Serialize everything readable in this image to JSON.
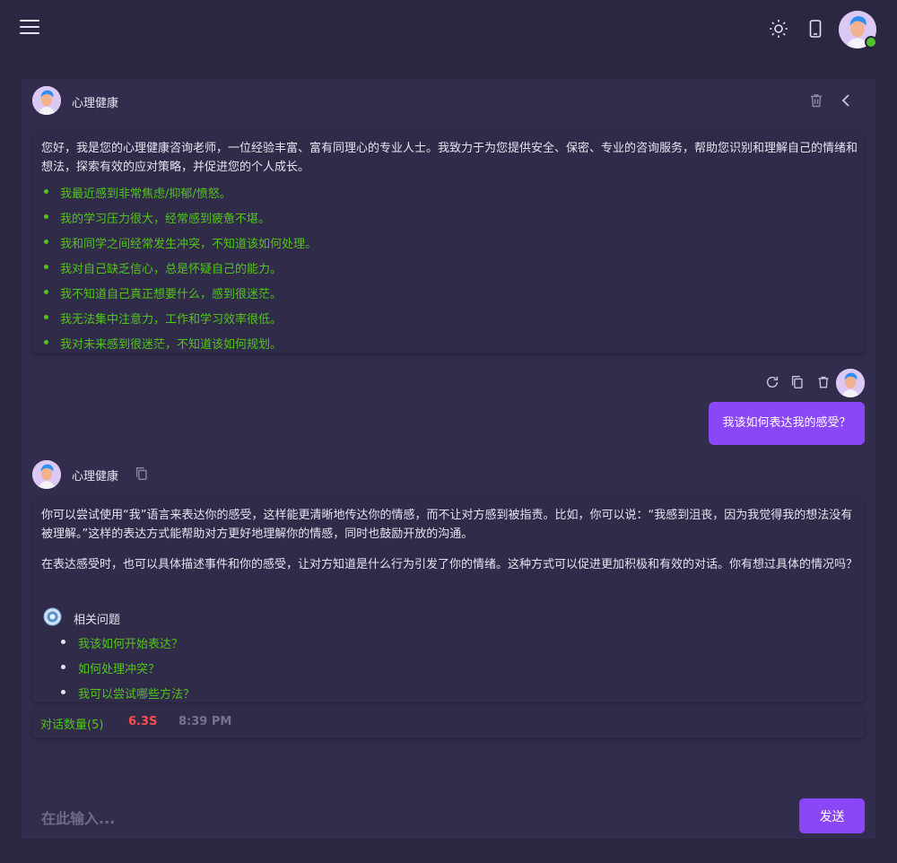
{
  "topbar": {
    "icons": {
      "menu": "menu-icon",
      "theme": "sun-icon",
      "device": "mobile-icon",
      "avatar": "user-avatar"
    },
    "online_color": "#4fc32a"
  },
  "chat": {
    "bot_name": "心理健康",
    "intro": {
      "text": "您好，我是您的心理健康咨询老师，一位经验丰富、富有同理心的专业人士。我致力于为您提供安全、保密、专业的咨询服务，帮助您识别和理解自己的情绪和想法，探索有效的应对策略，并促进您的个人成长。",
      "suggestions": [
        "我最近感到非常焦虑/抑郁/愤怒。",
        "我的学习压力很大，经常感到疲惫不堪。",
        "我和同学之间经常发生冲突，不知道该如何处理。",
        "我对自己缺乏信心，总是怀疑自己的能力。",
        "我不知道自己真正想要什么，感到很迷茫。",
        "我无法集中注意力，工作和学习效率很低。",
        "我对未来感到很迷茫，不知道该如何规划。"
      ]
    },
    "user_message": "我该如何表达我的感受？",
    "answer": {
      "paragraphs": [
        "你可以尝试使用“我”语言来表达你的感受，这样能更清晰地传达你的情感，而不让对方感到被指责。比如，你可以说：“我感到沮丧，因为我觉得我的想法没有被理解。”这样的表达方式能帮助对方更好地理解你的情感，同时也鼓励开放的沟通。",
        "在表达感受时，也可以具体描述事件和你的感受，让对方知道是什么行为引发了你的情绪。这种方式可以促进更加积极和有效的对话。你有想过具体的情况吗？"
      ],
      "related_title": "相关问题",
      "related": [
        "我该如何开始表达？",
        "如何处理冲突？",
        "我可以尝试哪些方法？"
      ]
    },
    "stats": {
      "count": "对话数量(5)",
      "duration": "6.3S",
      "time": "8:39 PM"
    }
  },
  "input": {
    "placeholder": "在此输入...",
    "value": "",
    "send_label": "发送"
  },
  "colors": {
    "background": "#2b2740",
    "panel": "#332d4d",
    "card": "#312b4a",
    "accent": "#8b47f7",
    "suggestion": "#52c41a",
    "duration": "#ff4d4f",
    "muted": "#77738c"
  }
}
